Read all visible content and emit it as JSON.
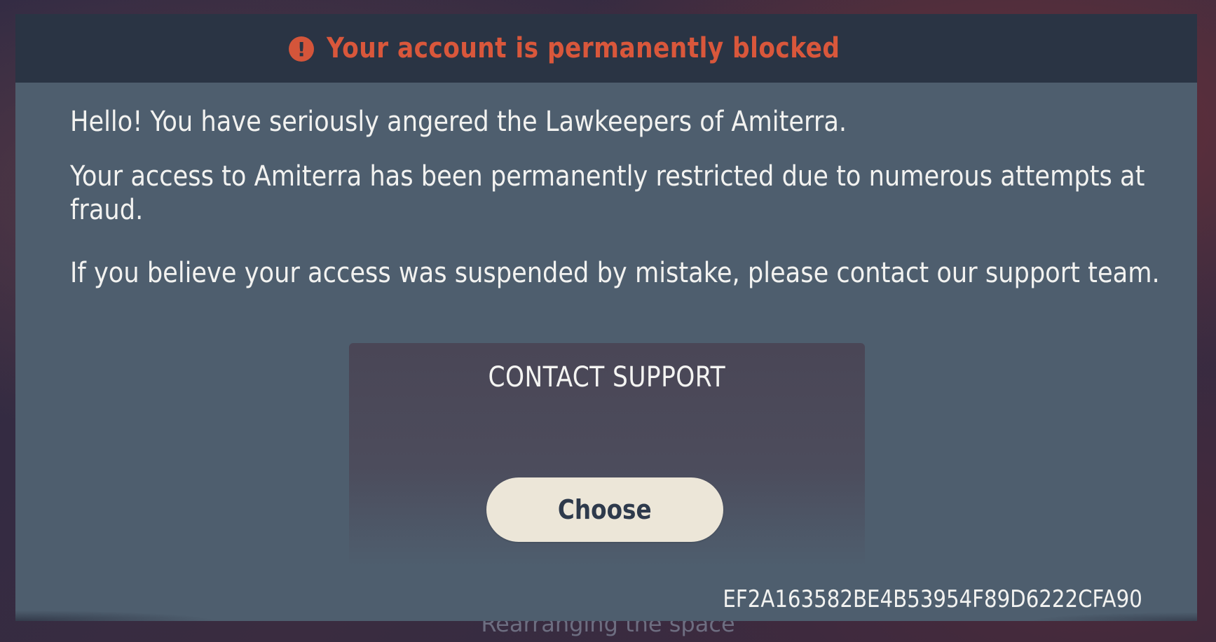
{
  "background": {
    "status_text": "Rearranging the space"
  },
  "modal": {
    "title": "Your account is permanently blocked",
    "title_icon": "alert-exclamation-icon",
    "title_icon_glyph": "!",
    "paragraphs": [
      "Hello! You have seriously angered the Lawkeepers of Amiterra.",
      "Your access to Amiterra has been permanently restricted due to numerous attempts at fraud.",
      "If you believe your access was suspended by mistake, please contact our support team."
    ],
    "contact": {
      "title": "CONTACT SUPPORT",
      "button_label": "Choose"
    },
    "session_id": "EF2A163582BE4B53954F89D6222CFA90"
  },
  "colors": {
    "header_bg": "#2a3444",
    "modal_bg": "#4e5e6e",
    "alert": "#d9573b",
    "button_bg": "#ece6d8",
    "button_text": "#2e3a4c"
  }
}
